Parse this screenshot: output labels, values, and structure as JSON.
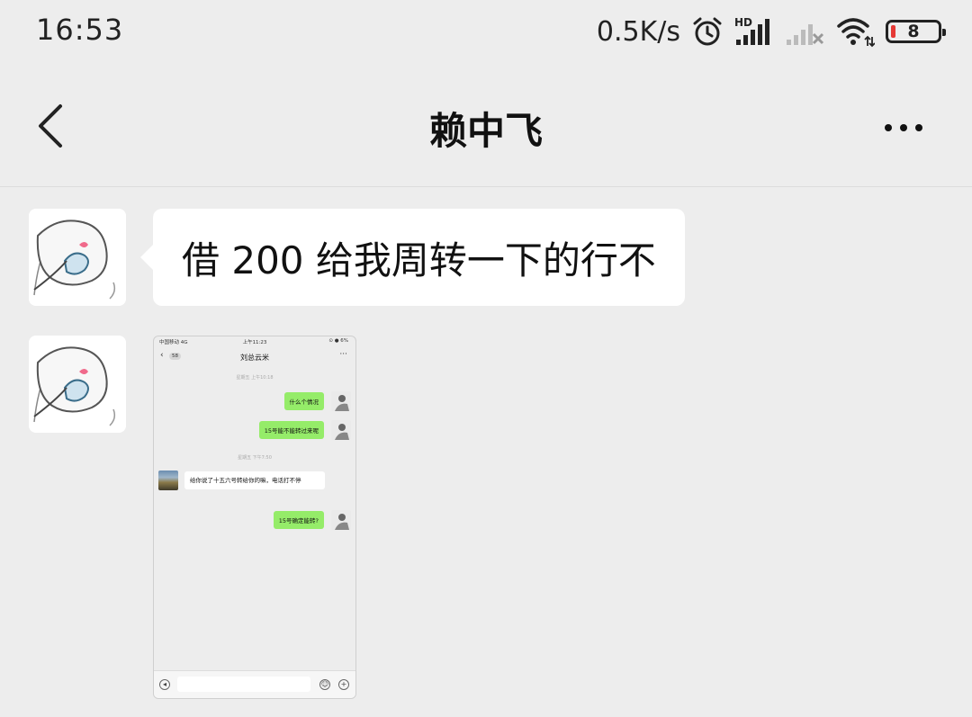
{
  "status_bar": {
    "time": "16:53",
    "net_speed": "0.5K/s",
    "icons": [
      "alarm-icon",
      "hd-signal-icon",
      "signal-no-service-icon",
      "wifi-icon",
      "battery-icon"
    ],
    "signal_label": "HD",
    "battery_level": "8",
    "battery_color": "#e53935"
  },
  "nav": {
    "back_icon": "chevron-left-icon",
    "title": "赖中飞",
    "more_icon": "more-dots-icon"
  },
  "messages": [
    {
      "type": "text",
      "sender": "contact",
      "text": "借 200 给我周转一下的行不"
    },
    {
      "type": "image",
      "sender": "contact"
    }
  ],
  "embedded_screenshot": {
    "status_left": "中国移动 4G",
    "status_center": "上午11:23",
    "status_right": "⊙ ● 6%",
    "back_unread": "58",
    "title": "刘总云米",
    "time_1": "星期五 上午10:18",
    "time_2": "星期五 下午7:50",
    "msg_1": "什么个情况",
    "msg_2": "15号能不能转过来呢",
    "msg_3": "给你说了十五六号转给你的嘛，电话打不停",
    "msg_4": "15号确定能转?",
    "sent_bubble_color": "#95ec69"
  },
  "colors": {
    "background": "#ededed",
    "bubble": "#ffffff"
  }
}
